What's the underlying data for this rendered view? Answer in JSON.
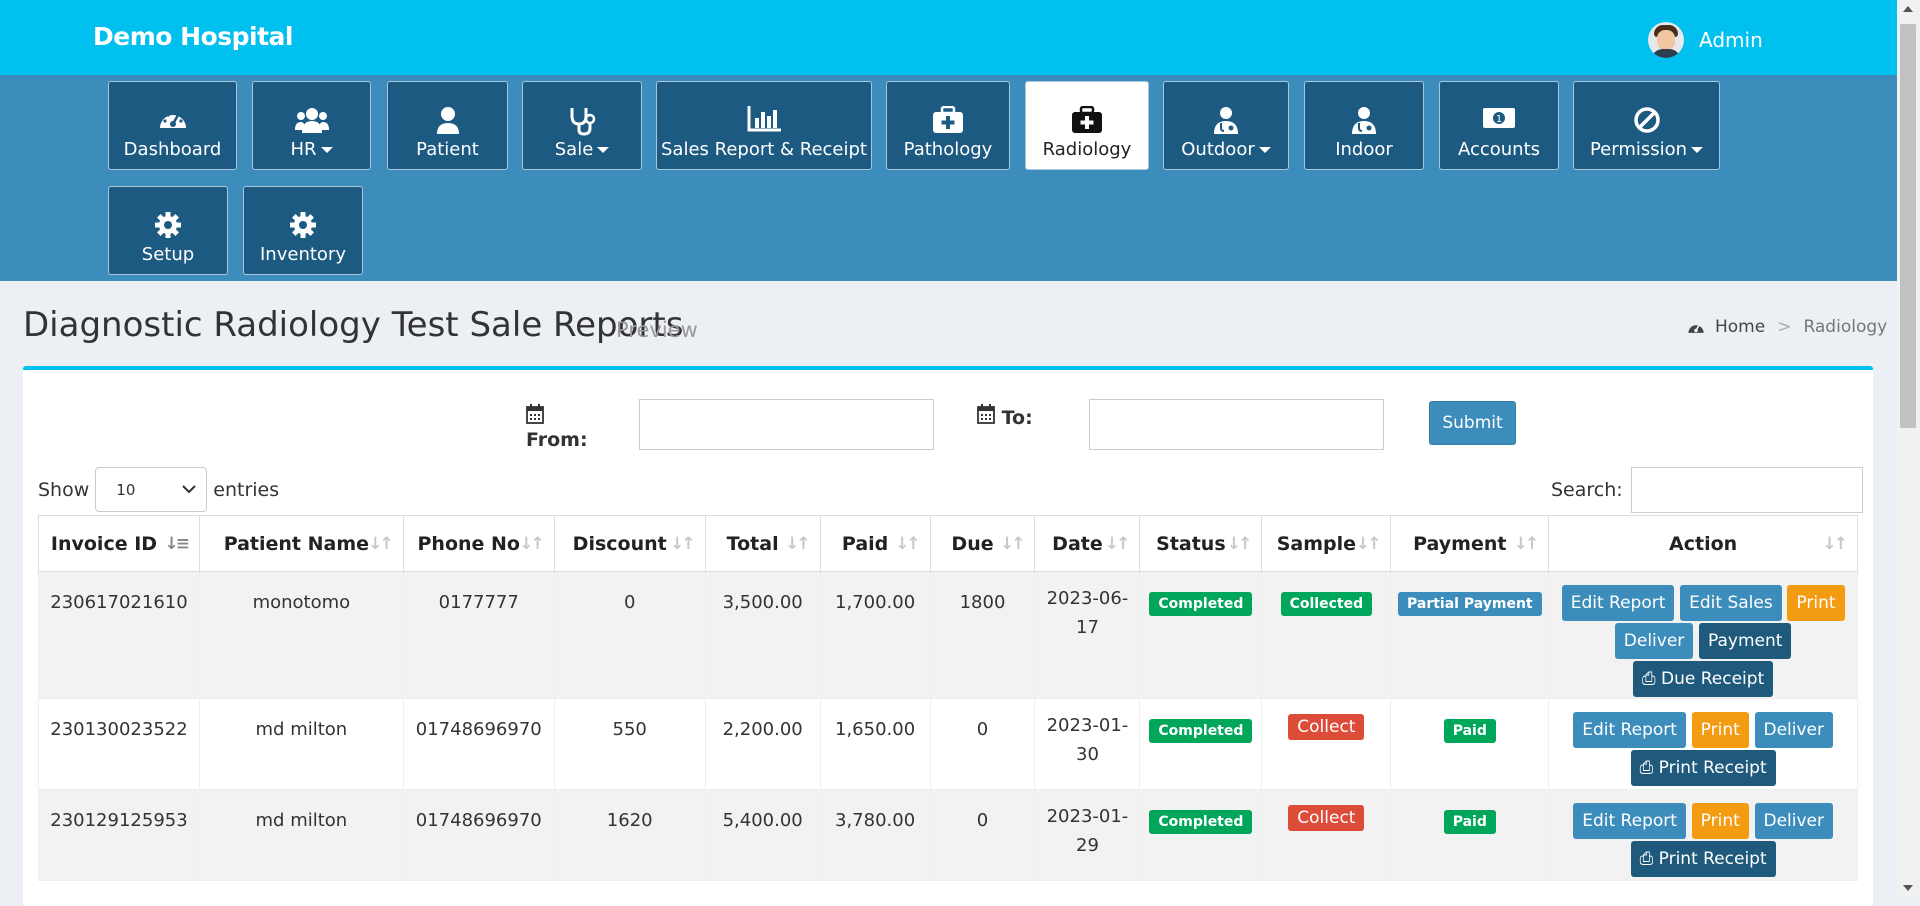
{
  "brand": "Demo Hospital",
  "user": {
    "name": "Admin"
  },
  "nav": [
    {
      "label": "Dashboard",
      "icon": "dashboard-icon",
      "dropdown": false
    },
    {
      "label": "HR",
      "icon": "users-icon",
      "dropdown": true
    },
    {
      "label": "Patient",
      "icon": "user-icon",
      "dropdown": false
    },
    {
      "label": "Sale",
      "icon": "stethoscope-icon",
      "dropdown": true
    },
    {
      "label": "Sales Report & Receipt",
      "icon": "bar-chart-icon",
      "dropdown": false
    },
    {
      "label": "Pathology",
      "icon": "medkit-icon",
      "dropdown": false
    },
    {
      "label": "Radiology",
      "icon": "medkit-icon",
      "dropdown": false,
      "active": true
    },
    {
      "label": "Outdoor",
      "icon": "doctor-icon",
      "dropdown": true
    },
    {
      "label": "Indoor",
      "icon": "doctor-icon",
      "dropdown": false
    },
    {
      "label": "Accounts",
      "icon": "money-icon",
      "dropdown": false
    },
    {
      "label": "Permission",
      "icon": "ban-icon",
      "dropdown": true
    },
    {
      "label": "Setup",
      "icon": "gear-icon",
      "dropdown": false
    },
    {
      "label": "Inventory",
      "icon": "gear-icon",
      "dropdown": false
    }
  ],
  "page": {
    "title": "Diagnostic Radiology Test Sale Reports",
    "subtitle": "Preview",
    "breadcrumb": {
      "home": "Home",
      "current": "Radiology"
    }
  },
  "filter": {
    "from_label": "From:",
    "to_label": "To:",
    "submit": "Submit"
  },
  "table_controls": {
    "show": "Show",
    "entries_value": "10",
    "entries": "entries",
    "search_label": "Search:"
  },
  "columns": [
    "Invoice ID",
    "Patient Name",
    "Phone No",
    "Discount",
    "Total",
    "Paid",
    "Due",
    "Date",
    "Status",
    "Sample",
    "Payment",
    "Action"
  ],
  "rows": [
    {
      "invoice": "230617021610",
      "patient": "monotomo",
      "phone": "0177777",
      "discount": "0",
      "total": "3,500.00",
      "paid": "1,700.00",
      "due": "1800",
      "date1": "2023-06-",
      "date2": "17",
      "status": "Completed",
      "sample": "Collected",
      "payment": "Partial Payment",
      "actions": {
        "edit_report": "Edit Report",
        "edit_sales": "Edit Sales",
        "print": "Print",
        "deliver": "Deliver",
        "payment": "Payment",
        "receipt": "Due Receipt"
      }
    },
    {
      "invoice": "230130023522",
      "patient": "md milton",
      "phone": "01748696970",
      "discount": "550",
      "total": "2,200.00",
      "paid": "1,650.00",
      "due": "0",
      "date1": "2023-01-",
      "date2": "30",
      "status": "Completed",
      "sample": "Collect",
      "payment": "Paid",
      "actions": {
        "edit_report": "Edit Report",
        "print": "Print",
        "deliver": "Deliver",
        "receipt": "Print Receipt"
      }
    },
    {
      "invoice": "230129125953",
      "patient": "md milton",
      "phone": "01748696970",
      "discount": "1620",
      "total": "5,400.00",
      "paid": "3,780.00",
      "due": "0",
      "date1": "2023-01-",
      "date2": "29",
      "status": "Completed",
      "sample": "Collect",
      "payment": "Paid",
      "actions": {
        "edit_report": "Edit Report",
        "print": "Print",
        "deliver": "Deliver",
        "receipt": "Print Receipt"
      }
    }
  ]
}
